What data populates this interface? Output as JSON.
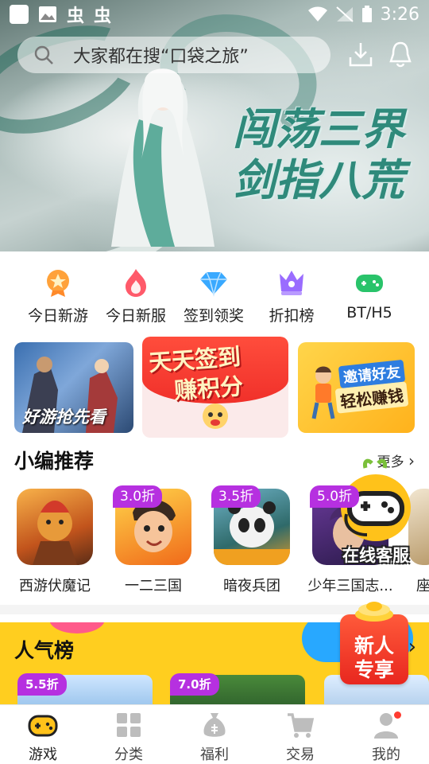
{
  "status_bar": {
    "time": "3:26"
  },
  "search": {
    "placeholder": "大家都在搜“口袋之旅”"
  },
  "banner": {
    "title_line1": "闯荡三界",
    "title_line2": "剑指八荒"
  },
  "shortcuts": [
    {
      "label": "今日新游",
      "icon": "medal-icon",
      "color": "#ffa23a"
    },
    {
      "label": "今日新服",
      "icon": "flame-icon",
      "color": "#ff5a6a"
    },
    {
      "label": "签到领奖",
      "icon": "diamond-icon",
      "color": "#39a9ff"
    },
    {
      "label": "折扣榜",
      "icon": "crown-icon",
      "color": "#9a6cff"
    },
    {
      "label": "BT/H5",
      "icon": "gamepad-icon",
      "color": "#29c36a"
    }
  ],
  "promos": [
    {
      "text": "好游抢先看"
    },
    {
      "line1": "天天签到",
      "line2": "赚积分"
    },
    {
      "line1": "邀请好友",
      "line2": "轻松赚钱"
    }
  ],
  "recommend": {
    "title": "小编推荐",
    "more": "更多",
    "games": [
      {
        "name": "西游伏魔记",
        "tag": ""
      },
      {
        "name": "一二三国",
        "tag": "3.0折"
      },
      {
        "name": "暗夜兵团",
        "tag": "3.5折"
      },
      {
        "name": "少年三国志...",
        "tag": "5.0折"
      },
      {
        "name": "座",
        "tag": ""
      }
    ]
  },
  "popular": {
    "title": "人气榜",
    "tags": [
      "5.5折",
      "7.0折"
    ]
  },
  "floating": {
    "customer_service": "在线客服",
    "new_user_line1": "新人",
    "new_user_line2": "专享"
  },
  "tabbar": [
    {
      "label": "游戏",
      "icon": "gamepad-icon",
      "active": true
    },
    {
      "label": "分类",
      "icon": "grid-icon",
      "active": false
    },
    {
      "label": "福利",
      "icon": "moneybag-icon",
      "active": false
    },
    {
      "label": "交易",
      "icon": "cart-icon",
      "active": false
    },
    {
      "label": "我的",
      "icon": "user-icon",
      "active": false
    }
  ],
  "colors": {
    "accent": "#ffce1f",
    "tag": "#b630e0",
    "banner_title": "#2f8a7b"
  }
}
